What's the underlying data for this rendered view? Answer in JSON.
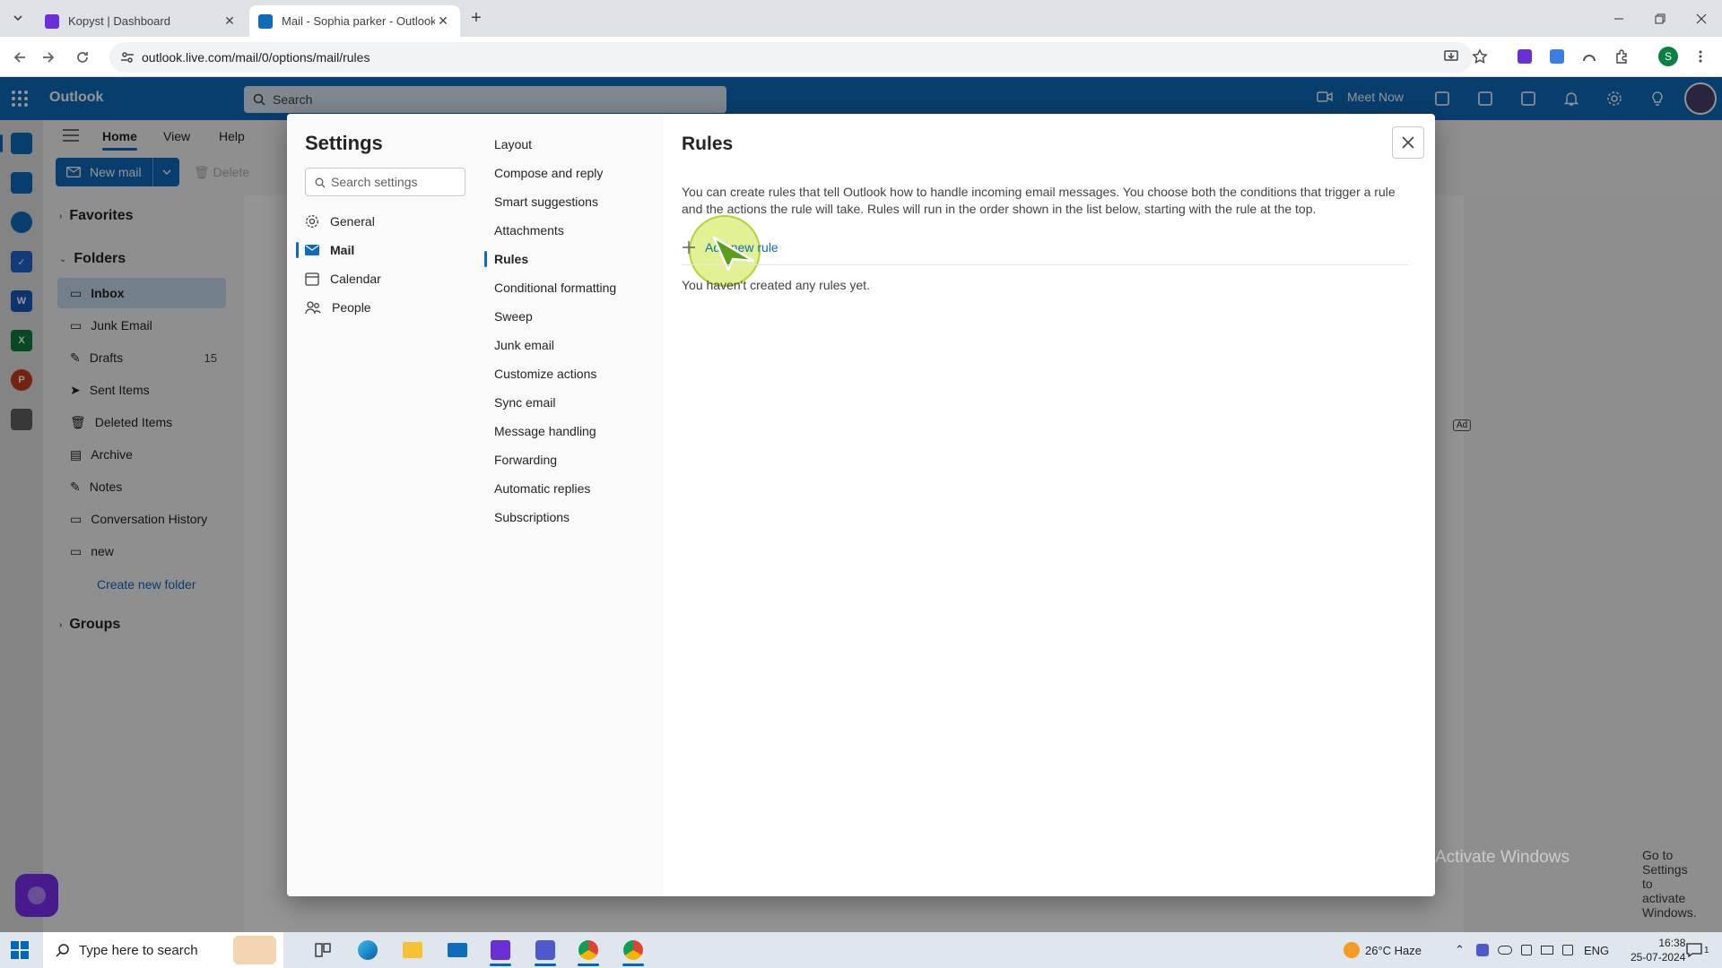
{
  "browser": {
    "tabs": [
      {
        "title": "Kopyst | Dashboard",
        "favicon": "kopyst-logo-icon",
        "active": false
      },
      {
        "title": "Mail - Sophia parker - Outlook",
        "favicon": "outlook-logo-icon",
        "active": true
      }
    ],
    "url": "outlook.live.com/mail/0/options/mail/rules"
  },
  "outlook": {
    "brand": "Outlook",
    "search_placeholder": "Search",
    "meet_now": "Meet Now",
    "ribbon_tabs": [
      "Home",
      "View",
      "Help"
    ],
    "new_mail": "New mail",
    "delete": "Delete"
  },
  "folders": {
    "favorites": "Favorites",
    "folders_header": "Folders",
    "items": [
      {
        "label": "Inbox",
        "icon": "inbox-icon",
        "count": ""
      },
      {
        "label": "Junk Email",
        "icon": "junk-icon",
        "count": ""
      },
      {
        "label": "Drafts",
        "icon": "drafts-icon",
        "count": "15"
      },
      {
        "label": "Sent Items",
        "icon": "sent-icon",
        "count": ""
      },
      {
        "label": "Deleted Items",
        "icon": "trash-icon",
        "count": ""
      },
      {
        "label": "Archive",
        "icon": "archive-icon",
        "count": ""
      },
      {
        "label": "Notes",
        "icon": "notes-icon",
        "count": ""
      },
      {
        "label": "Conversation History",
        "icon": "folder-icon",
        "count": ""
      },
      {
        "label": "new",
        "icon": "folder-icon",
        "count": ""
      }
    ],
    "create_new": "Create new folder",
    "groups": "Groups"
  },
  "ad_label": "Ad",
  "settings": {
    "title": "Settings",
    "search_placeholder": "Search settings",
    "categories": [
      {
        "label": "General",
        "icon": "gear-icon"
      },
      {
        "label": "Mail",
        "icon": "mail-icon"
      },
      {
        "label": "Calendar",
        "icon": "calendar-icon"
      },
      {
        "label": "People",
        "icon": "people-icon"
      }
    ],
    "subitems": [
      "Layout",
      "Compose and reply",
      "Smart suggestions",
      "Attachments",
      "Rules",
      "Conditional formatting",
      "Sweep",
      "Junk email",
      "Customize actions",
      "Sync email",
      "Message handling",
      "Forwarding",
      "Automatic replies",
      "Subscriptions"
    ],
    "selected_sub": "Rules"
  },
  "rules": {
    "title": "Rules",
    "description": "You can create rules that tell Outlook how to handle incoming email messages. You choose both the conditions that trigger a rule and the actions the rule will take. Rules will run in the order shown in the list below, starting with the rule at the top.",
    "add_new": "Add new rule",
    "empty": "You haven't created any rules yet."
  },
  "watermark": {
    "title": "Activate Windows",
    "subtitle": "Go to Settings to activate Windows."
  },
  "taskbar": {
    "search_placeholder": "Type here to search",
    "weather": "26°C  Haze",
    "language": "ENG",
    "time": "16:38",
    "date": "25-07-2024",
    "notification_count": "1"
  },
  "colors": {
    "accent": "#0f6cbd",
    "click_highlight": "#c8e63c"
  }
}
